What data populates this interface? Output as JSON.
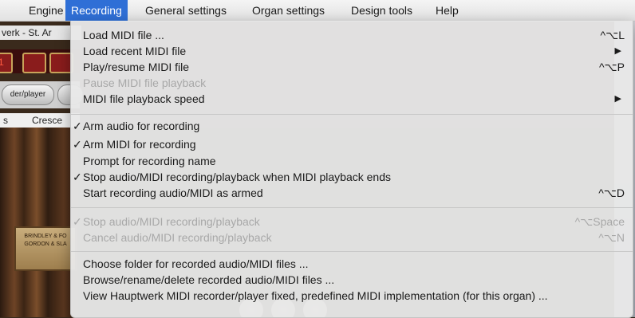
{
  "menubar": {
    "items": [
      "Engine",
      "Recording",
      "General settings",
      "Organ settings",
      "Design tools",
      "Help"
    ],
    "active": "Recording"
  },
  "background": {
    "window_title_fragment": "verk - St. Ar",
    "counter_digit": "1",
    "button_label": "der/player",
    "tab_left": "s",
    "tab_label": "Cresce",
    "plaque_lines": [
      "BRINDLEY & FO",
      "",
      "GORDON & SLA"
    ]
  },
  "recording_menu": {
    "group1": [
      {
        "label": "Load MIDI file ...",
        "shortcut": "^⌥L",
        "enabled": true,
        "checked": false
      },
      {
        "label": "Load recent MIDI file",
        "submenu": true,
        "enabled": true,
        "checked": false
      },
      {
        "label": "Play/resume MIDI file",
        "shortcut": "^⌥P",
        "enabled": true,
        "checked": false
      },
      {
        "label": "Pause MIDI file playback",
        "enabled": false,
        "checked": false
      },
      {
        "label": "MIDI file playback speed",
        "submenu": true,
        "enabled": true,
        "checked": false
      }
    ],
    "group2": [
      {
        "label": "Arm audio for recording",
        "enabled": true,
        "checked": true
      },
      {
        "label": "Arm MIDI for recording",
        "enabled": true,
        "checked": true
      },
      {
        "label": "Prompt for recording name",
        "enabled": true,
        "checked": false
      },
      {
        "label": "Stop audio/MIDI recording/playback when MIDI playback ends",
        "enabled": true,
        "checked": true
      },
      {
        "label": "Start recording audio/MIDI as armed",
        "shortcut": "^⌥D",
        "enabled": true,
        "checked": false
      }
    ],
    "group3": [
      {
        "label": "Stop audio/MIDI recording/playback",
        "shortcut": "^⌥Space",
        "enabled": false,
        "checked": true
      },
      {
        "label": "Cancel audio/MIDI recording/playback",
        "shortcut": "^⌥N",
        "enabled": false,
        "checked": false
      }
    ],
    "group4": [
      {
        "label": "Choose folder for recorded audio/MIDI files ...",
        "enabled": true,
        "checked": false
      },
      {
        "label": "Browse/rename/delete recorded audio/MIDI files ...",
        "enabled": true,
        "checked": false
      },
      {
        "label": "View Hauptwerk MIDI recorder/player fixed, predefined MIDI implementation (for this organ) ...",
        "enabled": true,
        "checked": false
      }
    ],
    "check_glyph": "✓",
    "submenu_glyph": "▶"
  },
  "colors": {
    "highlight": "#2f6fd6",
    "disabled_text": "#a8a8a8"
  }
}
